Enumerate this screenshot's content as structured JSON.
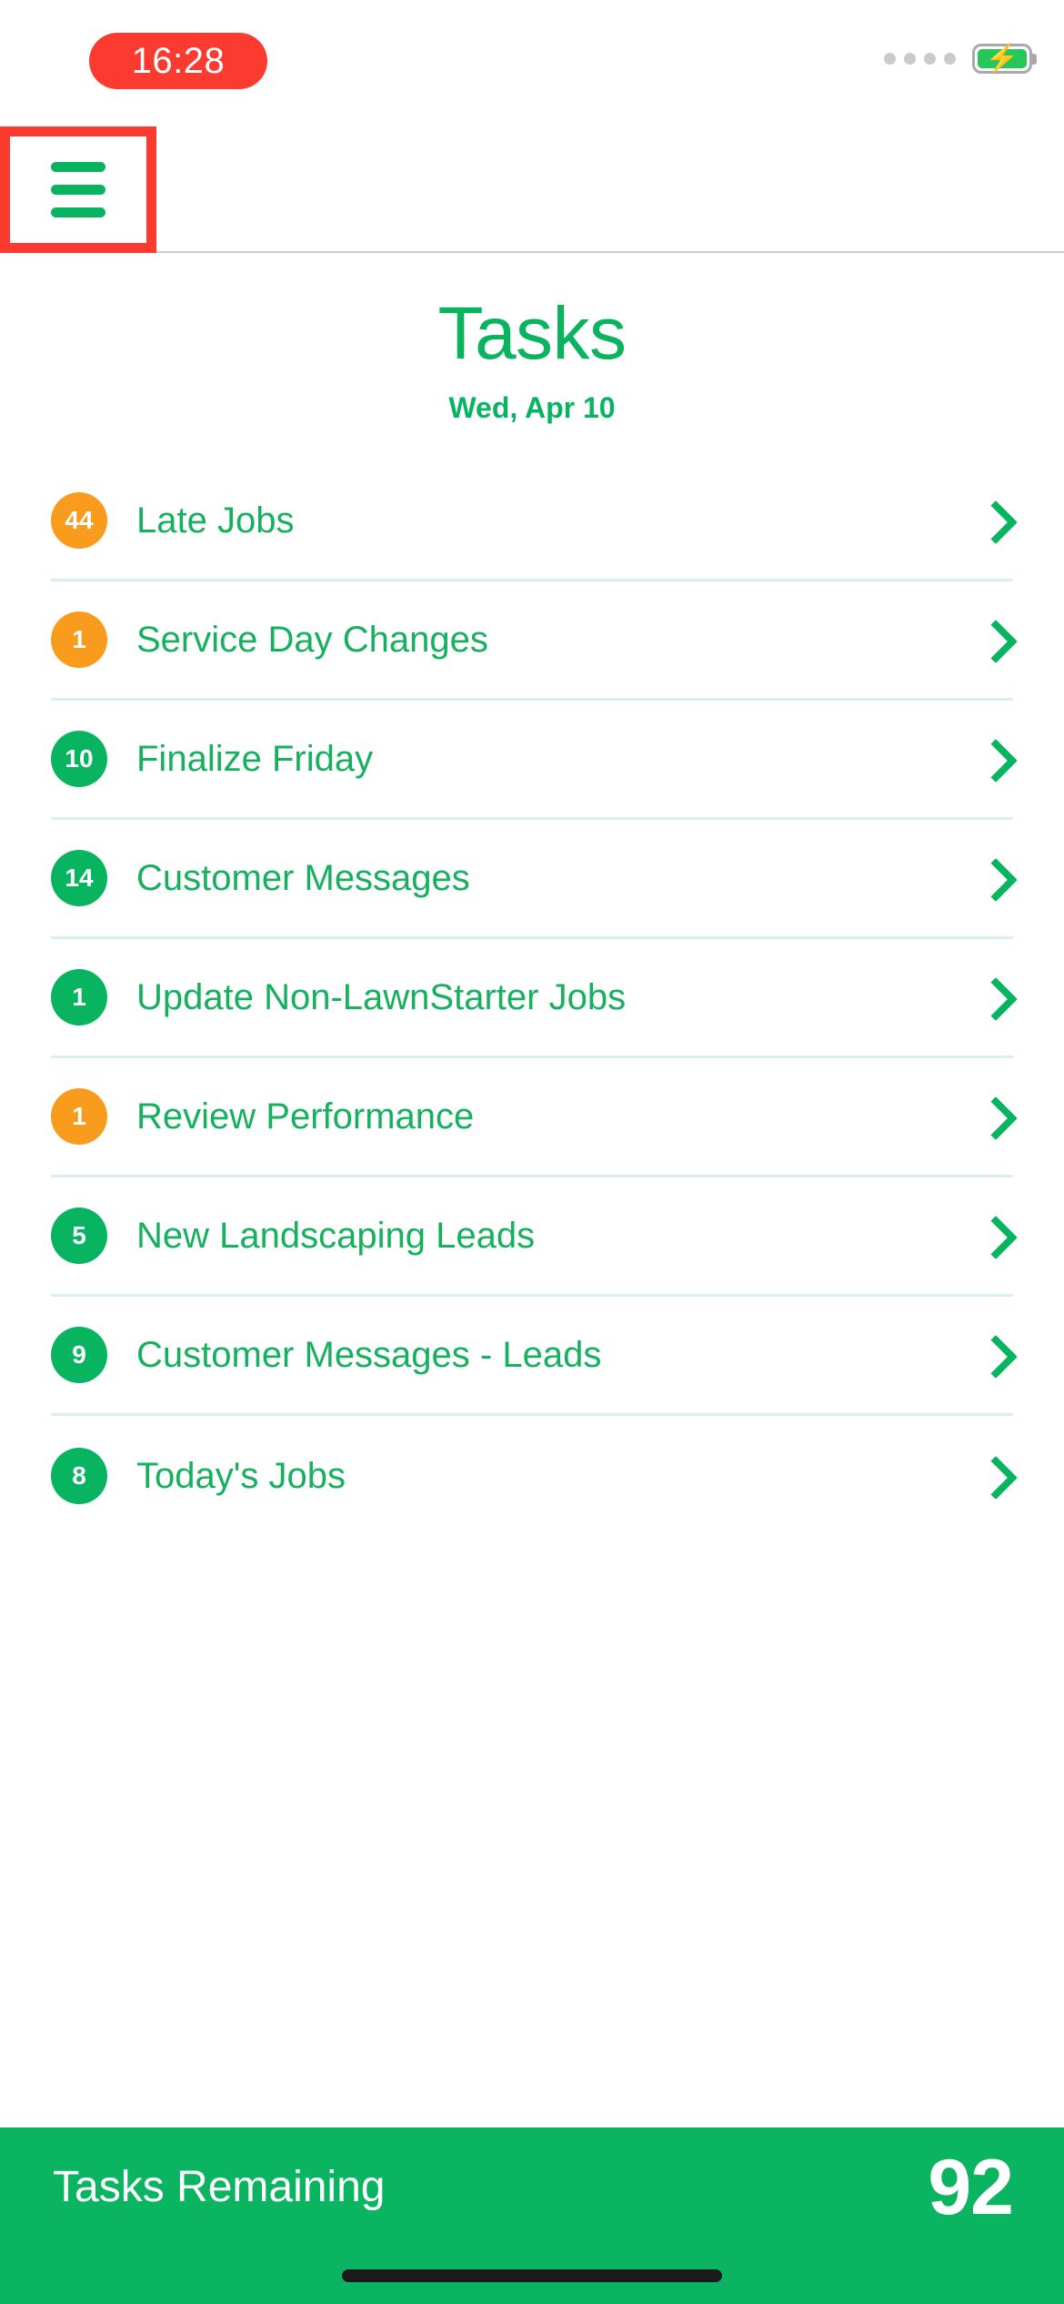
{
  "status_bar": {
    "time": "16:28",
    "time_pill_color": "#FB3B30",
    "signal_dots": 4,
    "battery_icon": "battery-charging-icon",
    "battery_fill_color": "#24C758",
    "bolt_glyph": "⚡"
  },
  "nav": {
    "menu_icon": "hamburger-menu-icon",
    "menu_color": "#09B461",
    "annotation_color": "#FB3B30"
  },
  "header": {
    "title": "Tasks",
    "date": "Wed, Apr 10",
    "title_color": "#0AB45F",
    "date_color": "#09B461"
  },
  "tasks": [
    {
      "count": "44",
      "label": "Late Jobs",
      "badge_color": "orange"
    },
    {
      "count": "1",
      "label": "Service Day Changes",
      "badge_color": "orange"
    },
    {
      "count": "10",
      "label": "Finalize Friday",
      "badge_color": "green"
    },
    {
      "count": "14",
      "label": "Customer Messages",
      "badge_color": "green"
    },
    {
      "count": "1",
      "label": "Update Non-LawnStarter Jobs",
      "badge_color": "green"
    },
    {
      "count": "1",
      "label": "Review Performance",
      "badge_color": "orange"
    },
    {
      "count": "5",
      "label": "New Landscaping Leads",
      "badge_color": "green"
    },
    {
      "count": "9",
      "label": "Customer Messages - Leads",
      "badge_color": "green"
    },
    {
      "count": "8",
      "label": "Today's Jobs",
      "badge_color": "green"
    }
  ],
  "footer": {
    "label": "Tasks Remaining",
    "count": "92",
    "background_color": "#0AB461"
  },
  "colors": {
    "brand_green": "#09B461",
    "badge_orange": "#F99B1C",
    "divider_green": "#DCF1E5",
    "nav_divider_gray": "#CCCCCC"
  }
}
